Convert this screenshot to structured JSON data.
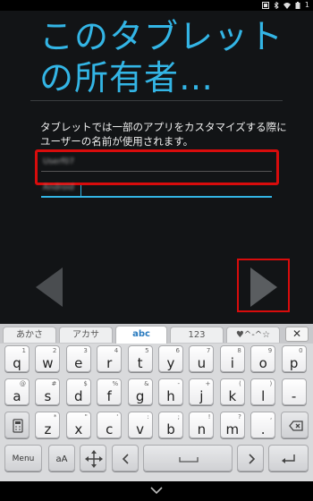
{
  "status_bar": {
    "time": "1",
    "icons": [
      "screenshot-icon",
      "bluetooth-icon",
      "wifi-icon",
      "battery-icon"
    ]
  },
  "title": "このタブレット\nの所有者…",
  "description": "タブレットでは一部のアプリをカスタマイズする際にユーザーの名前が使用されます。",
  "fields": {
    "first_name": "Userf07",
    "last_name": "Android"
  },
  "colors": {
    "accent": "#33b5e5",
    "highlight": "#d80c0c"
  },
  "keyboard": {
    "tabs": [
      "あかさ",
      "アカサ",
      "abc",
      "123",
      "♥^-^☆"
    ],
    "close_label": "✕",
    "rows": [
      [
        {
          "k": "q",
          "s": "1"
        },
        {
          "k": "w",
          "s": "2"
        },
        {
          "k": "e",
          "s": "3"
        },
        {
          "k": "r",
          "s": "4"
        },
        {
          "k": "t",
          "s": "5"
        },
        {
          "k": "y",
          "s": "6"
        },
        {
          "k": "u",
          "s": "7"
        },
        {
          "k": "i",
          "s": "8"
        },
        {
          "k": "o",
          "s": "9"
        },
        {
          "k": "p",
          "s": "0"
        }
      ],
      [
        {
          "k": "a",
          "s": "@"
        },
        {
          "k": "s",
          "s": "#"
        },
        {
          "k": "d",
          "s": "$"
        },
        {
          "k": "f",
          "s": "%"
        },
        {
          "k": "g",
          "s": "&"
        },
        {
          "k": "h",
          "s": "-"
        },
        {
          "k": "j",
          "s": "+"
        },
        {
          "k": "k",
          "s": "("
        },
        {
          "k": "l",
          "s": ")"
        },
        {
          "k": "-",
          "s": ""
        }
      ],
      [
        {
          "k": "z",
          "s": "*"
        },
        {
          "k": "x",
          "s": "\""
        },
        {
          "k": "c",
          "s": "'"
        },
        {
          "k": "v",
          "s": ":"
        },
        {
          "k": "b",
          "s": ";"
        },
        {
          "k": "n",
          "s": "!"
        },
        {
          "k": "m",
          "s": "?"
        },
        {
          "k": ".",
          "s": ","
        }
      ]
    ],
    "bottom": {
      "menu": "Menu",
      "shift": "aA"
    }
  }
}
